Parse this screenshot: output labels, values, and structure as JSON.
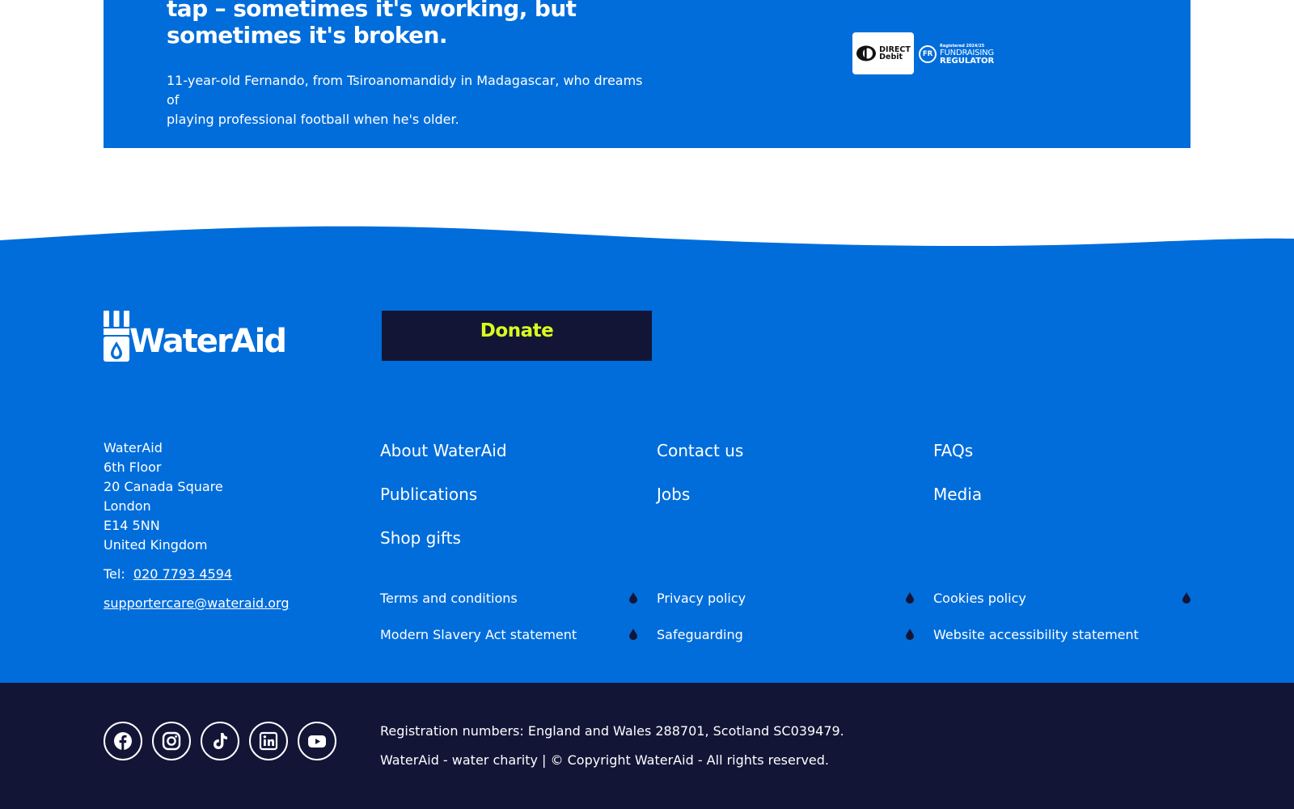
{
  "hero": {
    "headline_line1": "tap – sometimes it's working, but",
    "headline_line2": "sometimes it's broken.",
    "caption_line1": "11-year-old Fernando, from Tsiroanomandidy in Madagascar, who dreams of",
    "caption_line2": "playing professional football when he's older.",
    "direct_debit_line1": "DIRECT",
    "direct_debit_line2": "Debit",
    "fr_registered": "Registered 2024/25",
    "fr_initials": "FR",
    "fr_fundraising": "FUNDRAISING",
    "fr_regulator": "REGULATOR"
  },
  "footer": {
    "logo_text": "WaterAid",
    "donate_label": "Donate",
    "address": [
      "WaterAid",
      "6th Floor",
      "20 Canada Square",
      "London",
      "E14 5NN",
      "United Kingdom"
    ],
    "tel_label": "Tel:",
    "tel_number": "020 7793 4594",
    "email": "supportercare@wateraid.org",
    "nav_links": [
      "About WaterAid",
      "Contact us",
      "FAQs",
      "Publications",
      "Jobs",
      "Media",
      "Shop gifts"
    ],
    "legal_links": [
      "Terms and conditions",
      "Privacy policy",
      "Cookies policy",
      "Modern Slavery Act statement",
      "Safeguarding",
      "Website accessibility statement"
    ]
  },
  "bottom": {
    "social_icons": [
      "facebook-icon",
      "instagram-icon",
      "tiktok-icon",
      "linkedin-icon",
      "youtube-icon"
    ],
    "registration": "Registration numbers: England and Wales 288701, Scotland SC039479.",
    "copyright": "WaterAid - water charity | © Copyright WaterAid - All rights reserved."
  },
  "colors": {
    "brand_blue": "#006ddb",
    "navy": "#131537",
    "donate_text": "#d9ff1e",
    "white": "#ffffff"
  }
}
